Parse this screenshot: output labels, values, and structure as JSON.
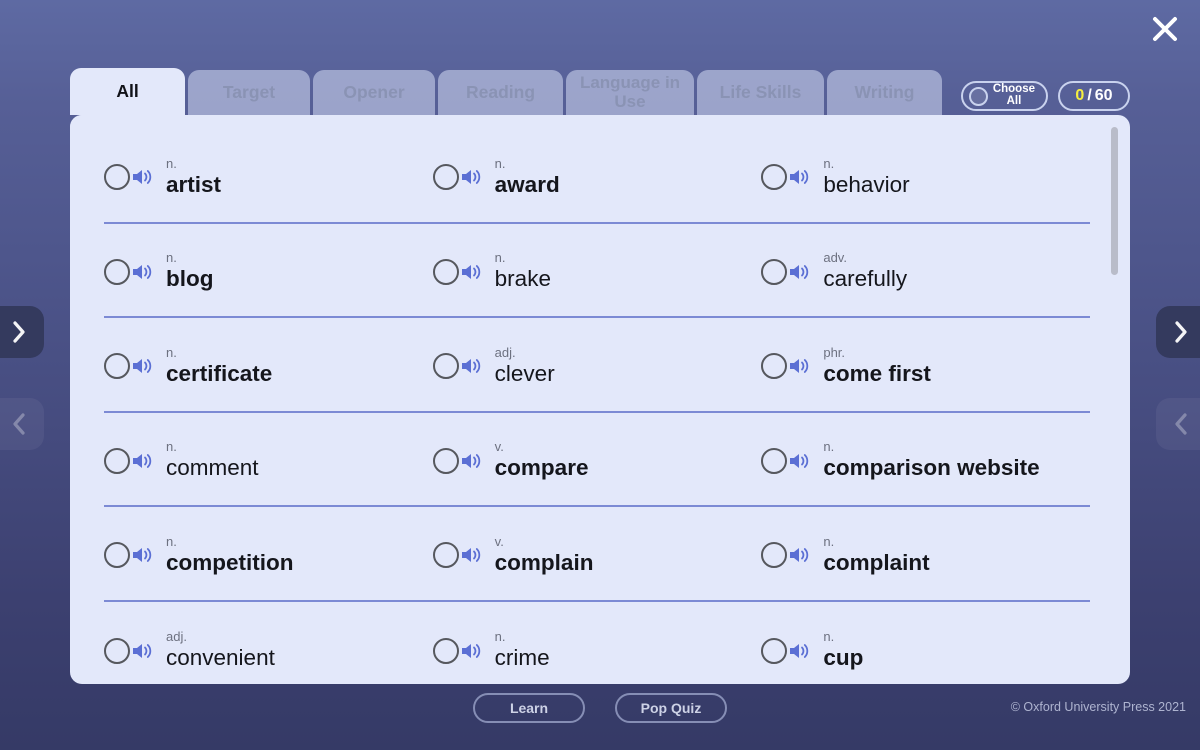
{
  "window": {
    "close_label": "×",
    "copyright": "© Oxford University Press 2021"
  },
  "colors": {
    "accent_yellow": "#f6ef3f",
    "panel_bg": "#e3e8fa",
    "active_tab_bg": "#e3e8fa",
    "inactive_tab_bg": "#d6def5",
    "divider": "#7c8ad4",
    "speaker_blue": "#5b6fd4",
    "bg_top": "#5e6aa3",
    "bg_bottom": "#353a66"
  },
  "tabs": [
    {
      "id": "all",
      "label": "All",
      "active": true
    },
    {
      "id": "target",
      "label": "Target",
      "active": false
    },
    {
      "id": "opener",
      "label": "Opener",
      "active": false
    },
    {
      "id": "reading",
      "label": "Reading",
      "active": false
    },
    {
      "id": "language",
      "label": "Language\nin Use",
      "active": false
    },
    {
      "id": "life",
      "label": "Life Skills",
      "active": false
    },
    {
      "id": "writing",
      "label": "Writing",
      "active": false
    }
  ],
  "toolbar": {
    "choose_all_label": "Choose\nAll",
    "choose_all_checked": false,
    "counter_current": "0",
    "counter_separator": "/",
    "counter_total": "60"
  },
  "nav": {
    "left_forward_icon": "chevron-right",
    "left_back_icon": "chevron-left",
    "right_forward_icon": "chevron-right",
    "right_back_icon": "chevron-left"
  },
  "word_list": {
    "rows": [
      [
        {
          "pos": "n.",
          "term": "artist",
          "bold": true,
          "checked": false
        },
        {
          "pos": "n.",
          "term": "award",
          "bold": true,
          "checked": false
        },
        {
          "pos": "n.",
          "term": "behavior",
          "bold": false,
          "checked": false
        }
      ],
      [
        {
          "pos": "n.",
          "term": "blog",
          "bold": true,
          "checked": false
        },
        {
          "pos": "n.",
          "term": "brake",
          "bold": false,
          "checked": false
        },
        {
          "pos": "adv.",
          "term": "carefully",
          "bold": false,
          "checked": false
        }
      ],
      [
        {
          "pos": "n.",
          "term": "certificate",
          "bold": true,
          "checked": false
        },
        {
          "pos": "adj.",
          "term": "clever",
          "bold": false,
          "checked": false
        },
        {
          "pos": "phr.",
          "term": "come first",
          "bold": true,
          "checked": false
        }
      ],
      [
        {
          "pos": "n.",
          "term": "comment",
          "bold": false,
          "checked": false
        },
        {
          "pos": "v.",
          "term": "compare",
          "bold": true,
          "checked": false
        },
        {
          "pos": "n.",
          "term": "comparison website",
          "bold": true,
          "checked": false
        }
      ],
      [
        {
          "pos": "n.",
          "term": "competition",
          "bold": true,
          "checked": false
        },
        {
          "pos": "v.",
          "term": "complain",
          "bold": true,
          "checked": false
        },
        {
          "pos": "n.",
          "term": "complaint",
          "bold": true,
          "checked": false
        }
      ],
      [
        {
          "pos": "adj.",
          "term": "convenient",
          "bold": false,
          "checked": false
        },
        {
          "pos": "n.",
          "term": "crime",
          "bold": false,
          "checked": false
        },
        {
          "pos": "n.",
          "term": "cup",
          "bold": true,
          "checked": false
        }
      ]
    ]
  },
  "footer": {
    "learn_label": "Learn",
    "pop_quiz_label": "Pop Quiz"
  }
}
